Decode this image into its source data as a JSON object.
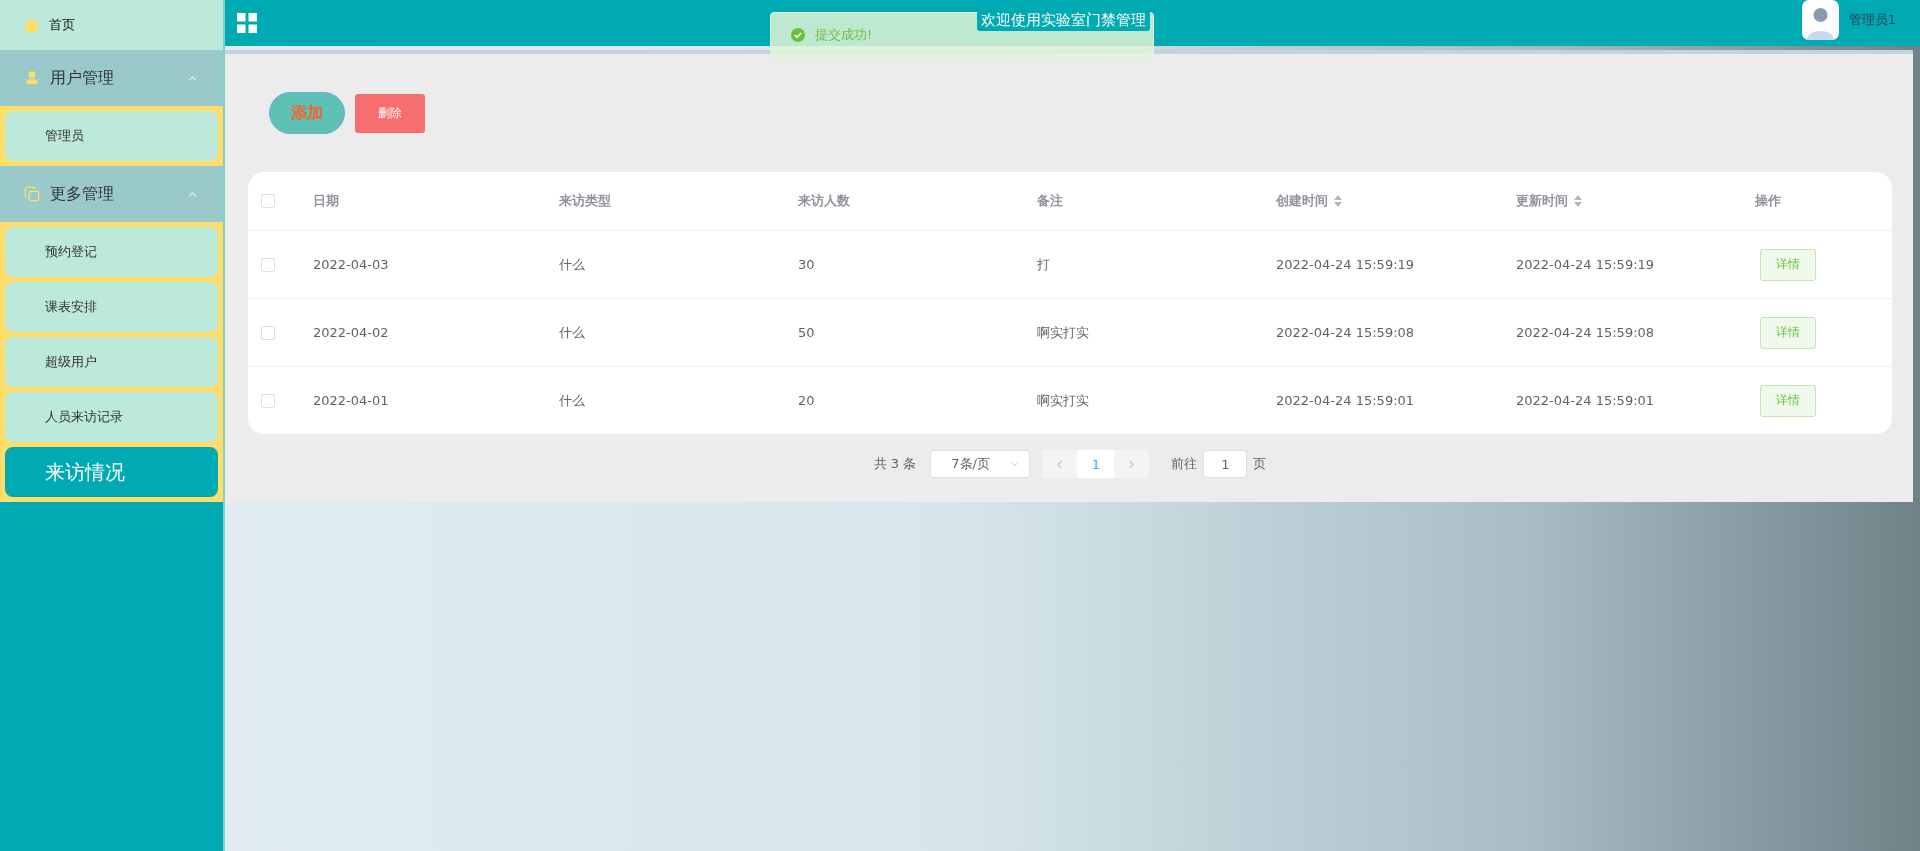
{
  "sidebar": {
    "items": [
      {
        "kind": "link",
        "label": "首页",
        "selected": false
      },
      {
        "kind": "group",
        "label": "用户管理",
        "expanded": true,
        "children": [
          {
            "label": "管理员",
            "selected": false
          }
        ]
      },
      {
        "kind": "group",
        "label": "更多管理",
        "expanded": true,
        "children": [
          {
            "label": "预约登记",
            "selected": false
          },
          {
            "label": "课表安排",
            "selected": false
          },
          {
            "label": "超级用户",
            "selected": false
          },
          {
            "label": "人员来访记录",
            "selected": false
          },
          {
            "label": "来访情况",
            "selected": true
          }
        ]
      }
    ]
  },
  "header": {
    "title": "欢迎使用实验室门禁管理",
    "user": "管理员1"
  },
  "toast": {
    "message": "提交成功!"
  },
  "toolbar": {
    "buttons": [
      {
        "kind": "add",
        "label": "添加"
      },
      {
        "kind": "delete",
        "label": "删除"
      }
    ]
  },
  "table": {
    "select_all": {
      "checked": false
    },
    "columns": [
      {
        "label": "日期",
        "sortable": false
      },
      {
        "label": "来访类型",
        "sortable": false
      },
      {
        "label": "来访人数",
        "sortable": false
      },
      {
        "label": "备注",
        "sortable": false
      },
      {
        "label": "创建时间",
        "sortable": true
      },
      {
        "label": "更新时间",
        "sortable": true
      },
      {
        "label": "操作",
        "sortable": false
      }
    ],
    "rows": [
      {
        "checked": false,
        "cells": [
          "2022-04-03",
          "什么",
          "30",
          "打",
          "2022-04-24 15:59:19",
          "2022-04-24 15:59:19"
        ],
        "action": "详情"
      },
      {
        "checked": false,
        "cells": [
          "2022-04-02",
          "什么",
          "50",
          "啊实打实",
          "2022-04-24 15:59:08",
          "2022-04-24 15:59:08"
        ],
        "action": "详情"
      },
      {
        "checked": false,
        "cells": [
          "2022-04-01",
          "什么",
          "20",
          "啊实打实",
          "2022-04-24 15:59:01",
          "2022-04-24 15:59:01"
        ],
        "action": "详情"
      }
    ]
  },
  "pagination": {
    "total": "共 3 条",
    "page_size": "7条/页",
    "pages": [
      {
        "label": "1",
        "selected": true
      }
    ],
    "goto_label": "前往",
    "goto_value": "1",
    "goto_suffix": "页"
  }
}
